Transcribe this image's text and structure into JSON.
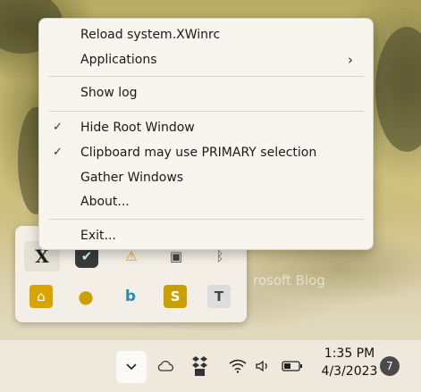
{
  "context_menu": {
    "items": [
      {
        "label": "Reload system.XWinrc",
        "checked": false,
        "has_submenu": false
      },
      {
        "label": "Applications",
        "checked": false,
        "has_submenu": true
      },
      {
        "label": "Show log",
        "checked": false,
        "has_submenu": false
      },
      {
        "label": "Hide Root Window",
        "checked": true,
        "has_submenu": false
      },
      {
        "label": "Clipboard may use PRIMARY selection",
        "checked": true,
        "has_submenu": false
      },
      {
        "label": "Gather Windows",
        "checked": false,
        "has_submenu": false
      },
      {
        "label": "About...",
        "checked": false,
        "has_submenu": false
      },
      {
        "label": "Exit...",
        "checked": false,
        "has_submenu": false
      }
    ],
    "check_glyph": "✓",
    "submenu_glyph": "›"
  },
  "tray_flyout": {
    "icons": [
      {
        "name": "xwin-icon",
        "glyph": "X"
      },
      {
        "name": "defender-icon",
        "glyph": "✔"
      },
      {
        "name": "warning-icon",
        "glyph": "⚠"
      },
      {
        "name": "display-icon",
        "glyph": "▣"
      },
      {
        "name": "bluetooth-icon",
        "glyph": "ᛒ"
      },
      {
        "name": "security-center-icon",
        "glyph": "⌂"
      },
      {
        "name": "chrome-icon",
        "glyph": "●"
      },
      {
        "name": "bing-icon",
        "glyph": "b"
      },
      {
        "name": "s-app-icon",
        "glyph": "S"
      },
      {
        "name": "teams-icon",
        "glyph": "T"
      }
    ]
  },
  "watermark": {
    "text": "rosoft Blog"
  },
  "taskbar": {
    "chevron_glyph": "⌄",
    "clock": {
      "time": "1:35 PM",
      "date": "4/3/2023"
    },
    "notification_count": "7"
  }
}
